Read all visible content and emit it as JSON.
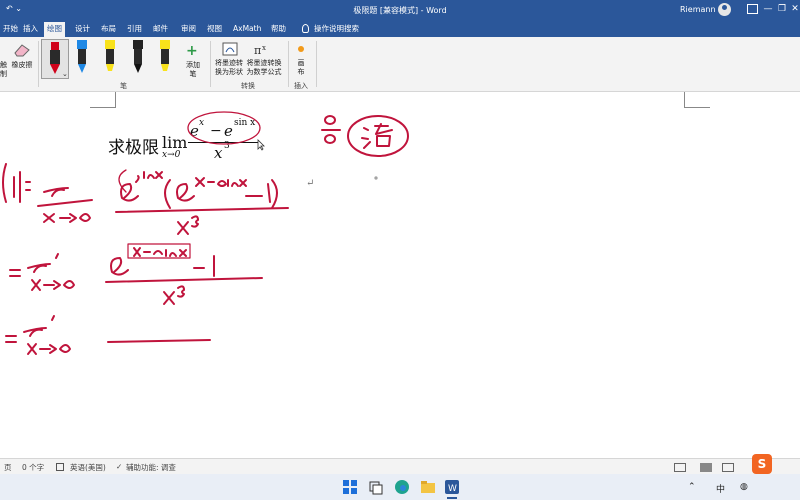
{
  "titlebar": {
    "quick_access": "↶ ⌄",
    "title": "极限题 [兼容模式] - Word",
    "user": "Riemann",
    "min": "—",
    "restore": "❐",
    "close": "✕"
  },
  "tabs": [
    {
      "label": "开始"
    },
    {
      "label": "插入"
    },
    {
      "label": "绘图"
    },
    {
      "label": "设计"
    },
    {
      "label": "布局"
    },
    {
      "label": "引用"
    },
    {
      "label": "邮件"
    },
    {
      "label": "审阅"
    },
    {
      "label": "视图"
    },
    {
      "label": "AxMath"
    },
    {
      "label": "帮助"
    }
  ],
  "tell_me": "操作说明搜索",
  "ribbon": {
    "eraser_left_label": "触\n制",
    "eraser_label": "橡皮擦",
    "add_pen_label": "添加\n笔",
    "pens_group": "笔",
    "ink_to_shape": "将墨迹转\n换为形状",
    "ink_to_math": "将墨迹转换\n为数学公式",
    "convert_group": "转换",
    "canvas_label": "画\n布",
    "insert_group": "插入",
    "pens": [
      {
        "color": "#d0021b"
      },
      {
        "color": "#1e88e5"
      },
      {
        "color": "#f9e21b"
      },
      {
        "color": "#222222"
      },
      {
        "color": "#f9e21b"
      }
    ]
  },
  "document": {
    "problem_prefix": "求极限",
    "lim": "lim",
    "lim_sub": "x→0",
    "numerator_e": "e",
    "numerator_exp": "x",
    "numerator_minus": "−",
    "numerator_e2": "e",
    "numerator_exp2": "sin x",
    "denominator": "x",
    "denominator_exp": "3",
    "return_mark": "↵"
  },
  "status": {
    "page": "页",
    "words": "0 个字",
    "language": "英语(美国)",
    "accessibility": "辅助功能: 调查"
  },
  "tray": {
    "ime": "中"
  },
  "sogou": "S"
}
